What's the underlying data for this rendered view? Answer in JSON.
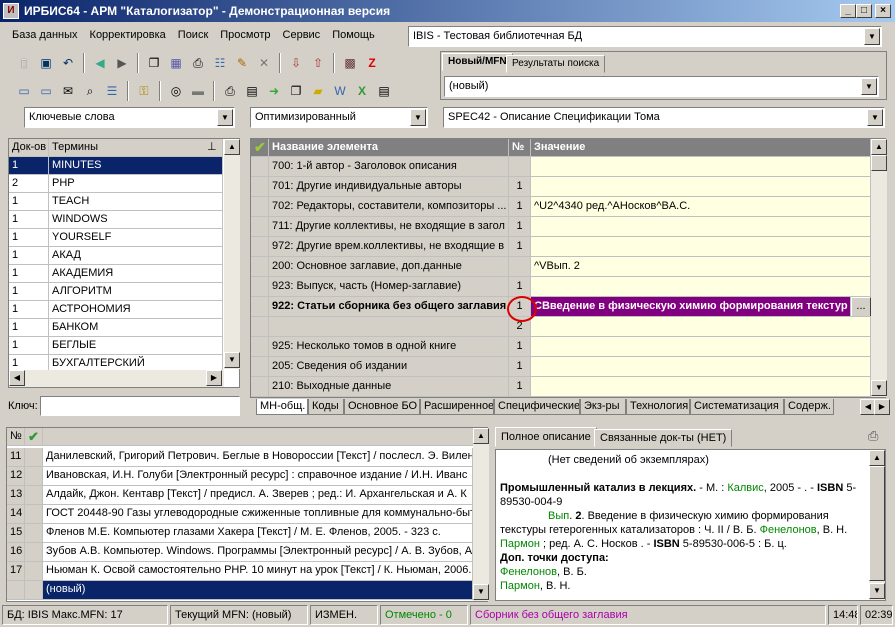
{
  "window": {
    "title": "ИРБИС64 - АРМ \"Каталогизатор\" - Демонстрационная версия",
    "icon": "irbis-app-icon"
  },
  "menu": [
    "База данных",
    "Корректировка",
    "Поиск",
    "Просмотр",
    "Сервис",
    "Помощь"
  ],
  "db_combo": "IBIS - Тестовая библиотечная БД",
  "right_tabs": [
    "Новый/MFN",
    "Результаты поиска"
  ],
  "new_combo": "(новый)",
  "search_mode": "Ключевые слова",
  "optim_combo": "Оптимизированный",
  "worksheet_combo": "SPEC42 - Описание Спецификации Тома",
  "terms": {
    "headers": [
      "Док-ов",
      "Термины"
    ],
    "rows": [
      [
        "1",
        "MINUTES"
      ],
      [
        "2",
        "PHP"
      ],
      [
        "1",
        "TEACH"
      ],
      [
        "1",
        "WINDOWS"
      ],
      [
        "1",
        "YOURSELF"
      ],
      [
        "1",
        "АКАД"
      ],
      [
        "1",
        "АКАДЕМИЯ"
      ],
      [
        "1",
        "АЛГОРИТМ"
      ],
      [
        "1",
        "АСТРОНОМИЯ"
      ],
      [
        "1",
        "БАНКОМ"
      ],
      [
        "1",
        "БЕГЛЫЕ"
      ],
      [
        "1",
        "БУХГАЛТЕРСКИЙ"
      ]
    ],
    "key_label": "Ключ:"
  },
  "editor": {
    "headers": [
      "Название элемента",
      "№",
      "Значение"
    ],
    "rows": [
      {
        "name": "700: 1-й автор - Заголовок описания",
        "num": "",
        "value": ""
      },
      {
        "name": "701: Другие индивидуальные авторы",
        "num": "1",
        "value": ""
      },
      {
        "name": "702: Редакторы, составители, композиторы ...",
        "num": "1",
        "value": "^U2^4340 ред.^AНосков^BA.C."
      },
      {
        "name": "711: Другие коллективы, не входящие в загол",
        "num": "1",
        "value": ""
      },
      {
        "name": "972: Другие врем.коллективы, не входящие в",
        "num": "1",
        "value": ""
      },
      {
        "name": "200: Основное заглавие, доп.данные",
        "num": "",
        "value": "^VВып. 2"
      },
      {
        "name": "923: Выпуск, часть (Номер-заглавие)",
        "num": "1",
        "value": ""
      },
      {
        "name": "922: Статьи сборника без общего заглавия",
        "num": "1",
        "value": "CВведение в физическую химию формирования текстур"
      },
      {
        "name": "",
        "num": "2",
        "value": ""
      },
      {
        "name": "925: Несколько томов в одной книге",
        "num": "1",
        "value": ""
      },
      {
        "name": "205: Сведения об издании",
        "num": "1",
        "value": ""
      },
      {
        "name": "210: Выходные данные",
        "num": "1",
        "value": ""
      }
    ],
    "ellipsis": "...",
    "tabs": [
      "МН-общ.",
      "Коды",
      "Основное БО",
      "Расширенное",
      "Специфические",
      "Экз-ры",
      "Технология",
      "Систематизация",
      "Содерж."
    ]
  },
  "records": {
    "rows": [
      {
        "n": "11",
        "text": "Данилевский, Григорий Петрович. Беглые в Новороссии [Текст] / послесл. Э. Вилен"
      },
      {
        "n": "12",
        "text": "Ивановская, И.Н. Голуби [Электронный ресурс] : справочное издание / И.Н. Иванс"
      },
      {
        "n": "13",
        "text": "Алдайк, Джон. Кентавр [Текст] / предисл. А. Зверев ; ред.: И. Архангельская и А. К"
      },
      {
        "n": "14",
        "text": "ГОСТ 20448-90 Газы углеводородные сжиженные топливные для коммунально-быт"
      },
      {
        "n": "15",
        "text": "Фленов М.Е. Компьютер глазами Хакера [Текст] / М. Е. Фленов, 2005. - 323 с."
      },
      {
        "n": "16",
        "text": "Зубов А.В. Компьютер. Windows. Программы [Электронный ресурс] / А. В. Зубов, А"
      },
      {
        "n": "17",
        "text": "Ньюман К. Освой самостоятельно PHP. 10 минут на урок [Текст] / К. Ньюман, 2006."
      },
      {
        "n": "",
        "text": "(новый)"
      }
    ]
  },
  "desc": {
    "tabs": [
      "Полное описание",
      "Связанные док-ты (НЕТ)"
    ],
    "line1": "(Нет сведений об экземплярах)",
    "l2a": "Промышленный катализ в лекциях.",
    "l2b": " - М. : ",
    "l2c": "Калвис",
    "l2d": ", 2005 -       . - ",
    "l2e": "ISBN",
    "l2f": " 5-89530-004-9",
    "l3a": "Вып",
    "l3b": ". ",
    "l3c": "2",
    "l3d": ". Введение в физическую химию формирования текстуры гетерогенных катализаторов : Ч. II / В. Б. ",
    "l3e": "Фенелонов",
    "l3f": ", В. Н. ",
    "l3g": "Пармон",
    "l3h": " ; ред. А. С. Носков . - ",
    "l3i": "ISBN",
    "l3j": " 5-89530-006-5 : Б. ц.",
    "l4": "Доп. точки доступа:",
    "l5a": "Фенелонов",
    "l5b": ", В. Б.",
    "l6a": "Пармон",
    "l6b": ", В. Н."
  },
  "status": {
    "db": "БД: IBIS Макс.MFN: 17",
    "cur": "Текущий MFN: (новый)",
    "changed": "ИЗМЕН.",
    "marked": "Отмечено - 0",
    "doc": "Сборник без общего заглавия",
    "time": "14:48",
    "time2": "02:39"
  },
  "colors": {
    "title": "#0a246a",
    "selected": "#0a246a",
    "purple": "#800080",
    "green": "#008000",
    "cream": "#ffffe1"
  }
}
